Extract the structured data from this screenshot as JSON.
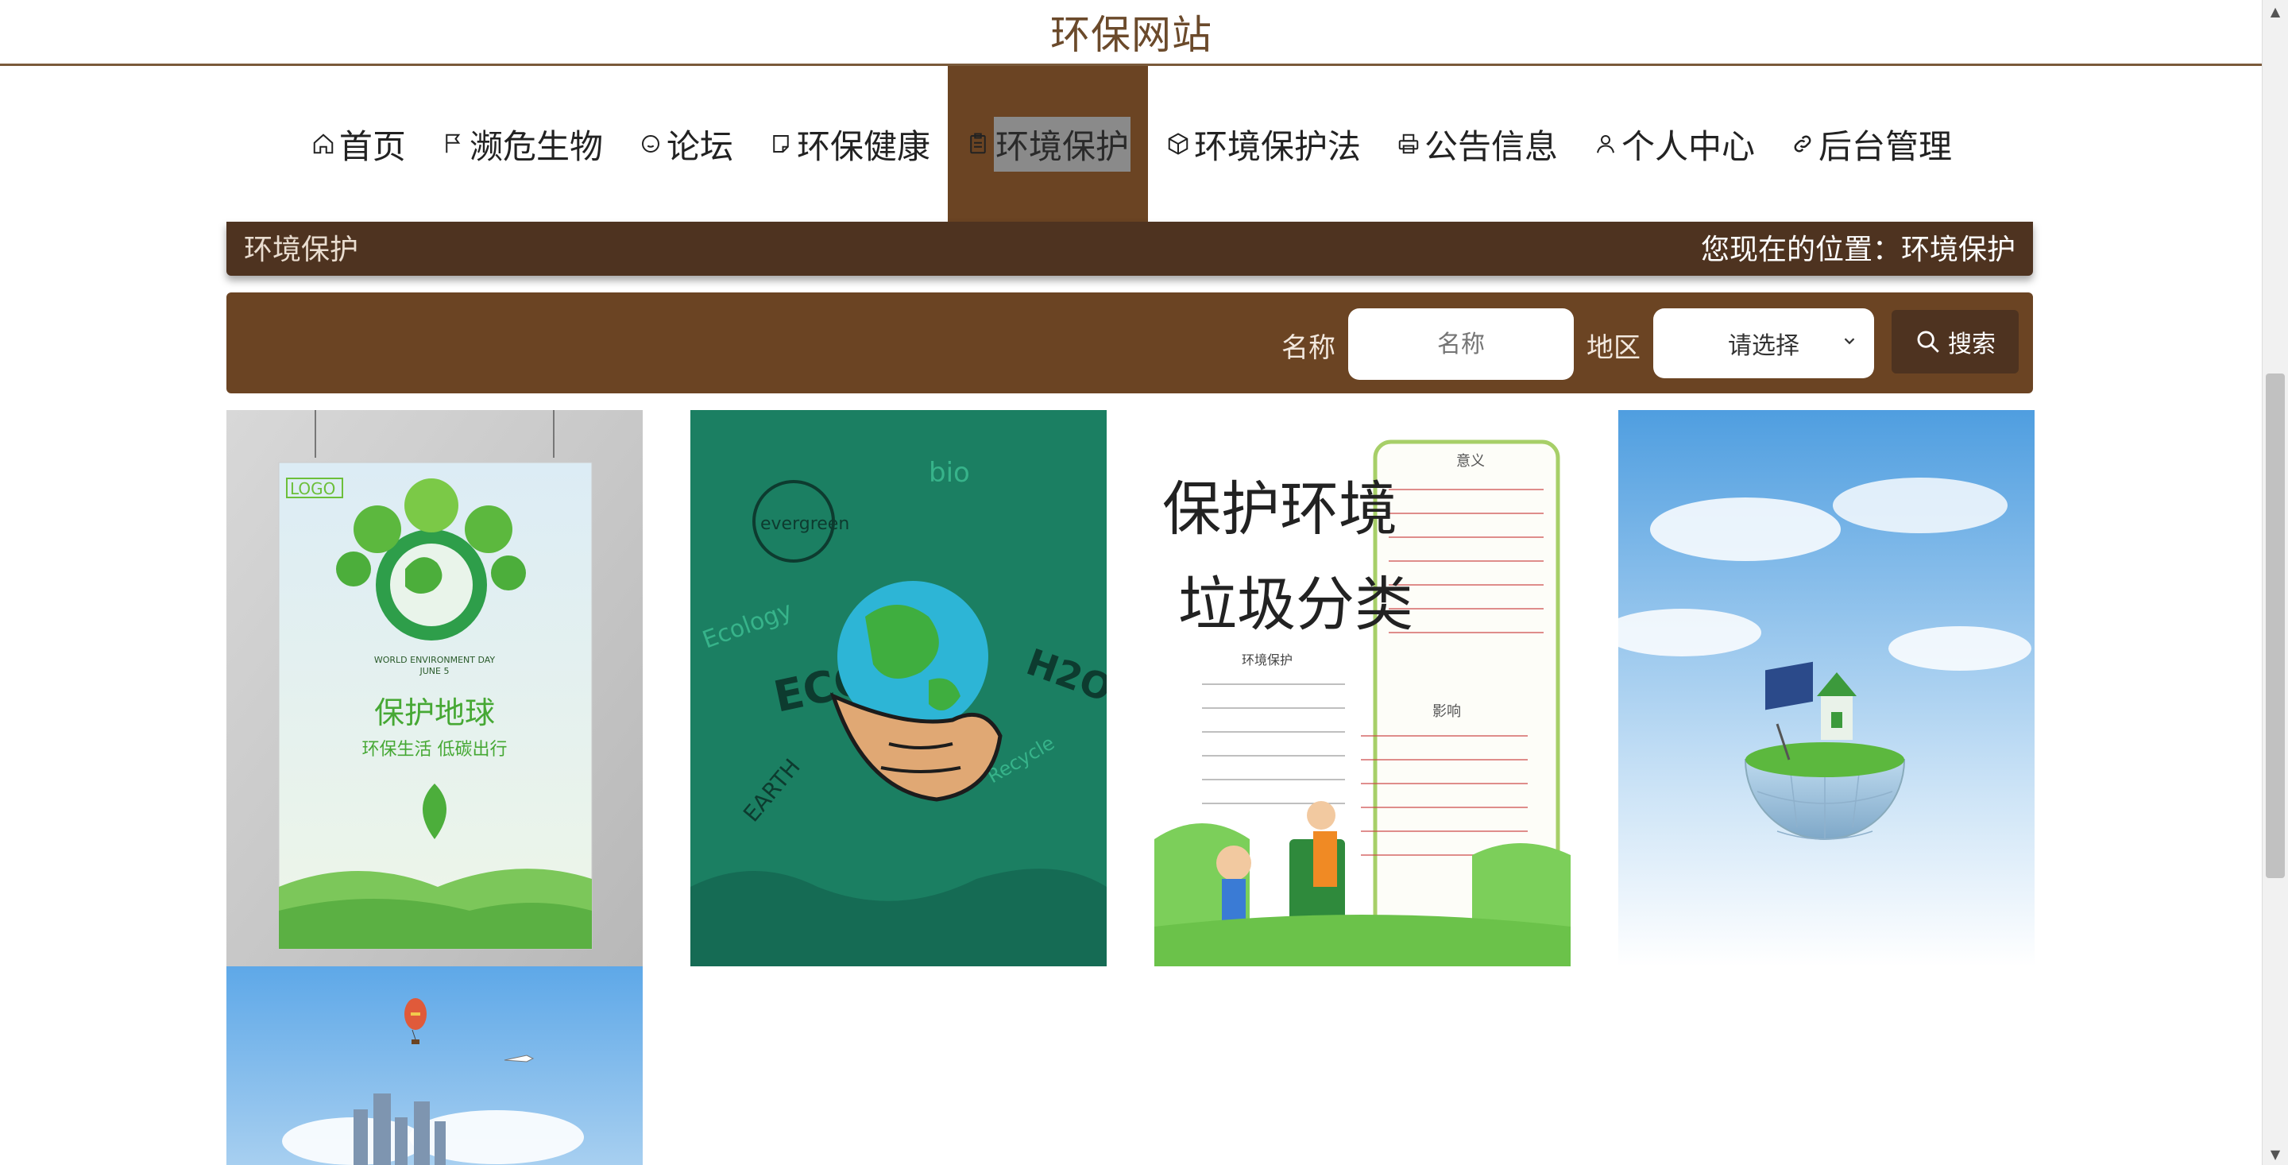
{
  "site": {
    "title": "环保网站"
  },
  "nav": {
    "items": [
      {
        "label": "首页",
        "icon": "home-icon"
      },
      {
        "label": "濒危生物",
        "icon": "flag-icon"
      },
      {
        "label": "论坛",
        "icon": "chat-bubble-icon"
      },
      {
        "label": "环保健康",
        "icon": "note-icon"
      },
      {
        "label": "环境保护",
        "icon": "clipboard-icon",
        "active": true
      },
      {
        "label": "环境保护法",
        "icon": "cube-icon"
      },
      {
        "label": "公告信息",
        "icon": "printer-icon"
      },
      {
        "label": "个人中心",
        "icon": "user-icon"
      },
      {
        "label": "后台管理",
        "icon": "link-icon"
      }
    ]
  },
  "breadcrumb": {
    "title": "环境保护",
    "position": "您现在的位置：环境保护"
  },
  "search": {
    "name_label": "名称",
    "name_placeholder": "名称",
    "region_label": "地区",
    "region_selected": "请选择",
    "button_label": "搜索"
  },
  "posters": {
    "p1_logo": "LOGO",
    "p1_title": "保护地球",
    "p1_subtitle": "环保生活  低碳出行",
    "p1_event": "WORLD ENVIRONMENT DAY",
    "p1_date": "JUNE 5",
    "p2_words": [
      "evergreen",
      "ECO",
      "Ecology",
      "EARTH",
      "H2O",
      "bio",
      "Recycle"
    ],
    "p3_title_line1": "保护环境",
    "p3_title_line2": "垃圾分类",
    "p3_heading1": "意义",
    "p3_heading2": "环境保护",
    "p3_heading3": "影响"
  },
  "colors": {
    "brand_brown": "#6b4423",
    "dark_brown": "#4e3320",
    "title_brown": "#6b4a2b"
  }
}
